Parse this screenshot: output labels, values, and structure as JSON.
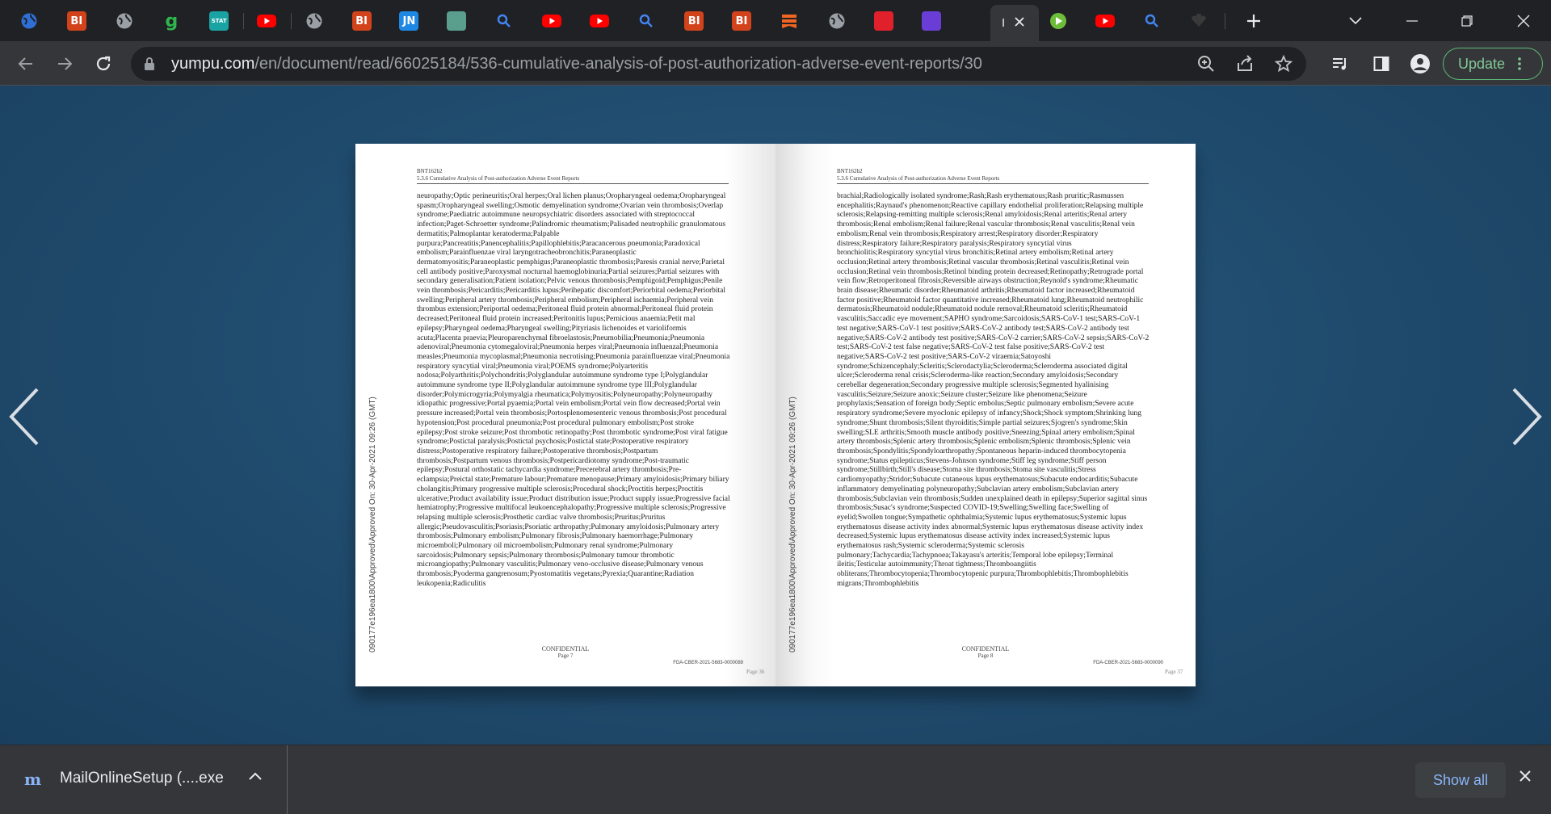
{
  "tabs": [
    {
      "icon": "globe-multicolor-icon",
      "label": "",
      "color": "#2f6fd6"
    },
    {
      "icon": "bi-logo-icon",
      "label": "BI",
      "color": "#d2431c"
    },
    {
      "icon": "globe-icon",
      "label": "",
      "color": "#9aa0a6"
    },
    {
      "icon": "g-logo-icon",
      "label": "g",
      "color": "#2fb64d"
    },
    {
      "icon": "stat-logo-icon",
      "label": "STAT",
      "color": "#1aa3a3"
    },
    {
      "icon": "youtube-icon",
      "label": "",
      "color": "#ff0000"
    },
    {
      "icon": "globe-icon",
      "label": "",
      "color": "#9aa0a6"
    },
    {
      "icon": "bi-logo-icon",
      "label": "BI",
      "color": "#d2431c"
    },
    {
      "icon": "jn-logo-icon",
      "label": "JN",
      "color": "#1e88e5"
    },
    {
      "icon": "medical-logo-icon",
      "label": "",
      "color": "#5a9e8e"
    },
    {
      "icon": "search-icon",
      "label": "",
      "color": "#4285f4"
    },
    {
      "icon": "youtube-icon",
      "label": "",
      "color": "#ff0000"
    },
    {
      "icon": "youtube-icon",
      "label": "",
      "color": "#ff0000"
    },
    {
      "icon": "search-icon",
      "label": "",
      "color": "#4285f4"
    },
    {
      "icon": "bi-logo-icon",
      "label": "BI",
      "color": "#d2431c"
    },
    {
      "icon": "bi-logo-icon",
      "label": "BI",
      "color": "#d2431c"
    },
    {
      "icon": "bookmark-stack-icon",
      "label": "",
      "color": "#f26522"
    },
    {
      "icon": "globe-icon",
      "label": "",
      "color": "#9aa0a6"
    },
    {
      "icon": "red-arrow-icon",
      "label": "",
      "color": "#e0202b"
    },
    {
      "icon": "purple-logo-icon",
      "label": "",
      "color": "#6a3dd6"
    }
  ],
  "tabs_after_active": [
    {
      "icon": "rumble-icon",
      "label": "",
      "color": "#6ebd3a"
    },
    {
      "icon": "youtube-icon",
      "label": "",
      "color": "#ff0000"
    },
    {
      "icon": "search-icon",
      "label": "",
      "color": "#4285f4"
    },
    {
      "icon": "nbc-logo-icon",
      "label": "",
      "color": "#1a1a1a"
    }
  ],
  "active_tab": {
    "label": "I"
  },
  "address_bar": {
    "host": "yumpu.com",
    "path": "/en/document/read/66025184/536-cumulative-analysis-of-post-authorization-adverse-event-reports/30"
  },
  "update_button": {
    "label": "Update"
  },
  "document": {
    "left_page": {
      "header_line1": "BNT162b2",
      "header_line2": "5.3.6 Cumulative Analysis of Post-authorization Adverse Event Reports",
      "body": "neuropathy;Optic perineuritis;Oral herpes;Oral lichen planus;Oropharyngeal oedema;Oropharyngeal spasm;Oropharyngeal swelling;Osmotic demyelination syndrome;Ovarian vein thrombosis;Overlap syndrome;Paediatric autoimmune neuropsychiatric disorders associated with streptococcal infection;Paget-Schroetter syndrome;Palindromic rheumatism;Palisaded neutrophilic granulomatous dermatitis;Palmoplantar keratoderma;Palpable purpura;Pancreatitis;Panencephalitis;Papillophlebitis;Paracancerous pneumonia;Paradoxical embolism;Parainfluenzae viral laryngotracheobronchitis;Paraneoplastic dermatomyositis;Paraneoplastic pemphigus;Paraneoplastic thrombosis;Paresis cranial nerve;Parietal cell antibody positive;Paroxysmal nocturnal haemoglobinuria;Partial seizures;Partial seizures with secondary generalisation;Patient isolation;Pelvic venous thrombosis;Pemphigoid;Pemphigus;Penile vein thrombosis;Pericarditis;Pericarditis lupus;Perihepatic discomfort;Periorbital oedema;Periorbital swelling;Peripheral artery thrombosis;Peripheral embolism;Peripheral ischaemia;Peripheral vein thrombus extension;Periportal oedema;Peritoneal fluid protein abnormal;Peritoneal fluid protein decreased;Peritoneal fluid protein increased;Peritonitis lupus;Pernicious anaemia;Petit mal epilepsy;Pharyngeal oedema;Pharyngeal swelling;Pityriasis lichenoides et varioliformis acuta;Placenta praevia;Pleuroparenchymal fibroelastosis;Pneumobilia;Pneumonia;Pneumonia adenoviral;Pneumonia cytomegaloviral;Pneumonia herpes viral;Pneumonia influenzal;Pneumonia measles;Pneumonia mycoplasmal;Pneumonia necrotising;Pneumonia parainfluenzae viral;Pneumonia respiratory syncytial viral;Pneumonia viral;POEMS syndrome;Polyarteritis nodosa;Polyarthritis;Polychondritis;Polyglandular autoimmune syndrome type I;Polyglandular autoimmune syndrome type II;Polyglandular autoimmune syndrome type III;Polyglandular disorder;Polymicrogyria;Polymyalgia rheumatica;Polymyositis;Polyneuropathy;Polyneuropathy idiopathic progressive;Portal pyaemia;Portal vein embolism;Portal vein flow decreased;Portal vein pressure increased;Portal vein thrombosis;Portosplenomesenteric venous thrombosis;Post procedural hypotension;Post procedural pneumonia;Post procedural pulmonary embolism;Post stroke epilepsy;Post stroke seizure;Post thrombotic retinopathy;Post thrombotic syndrome;Post viral fatigue syndrome;Postictal paralysis;Postictal psychosis;Postictal state;Postoperative respiratory distress;Postoperative respiratory failure;Postoperative thrombosis;Postpartum thrombosis;Postpartum venous thrombosis;Postpericardiotomy syndrome;Post-traumatic epilepsy;Postural orthostatic tachycardia syndrome;Precerebral artery thrombosis;Pre-eclampsia;Preictal state;Premature labour;Premature menopause;Primary amyloidosis;Primary biliary cholangitis;Primary progressive multiple sclerosis;Procedural shock;Proctitis herpes;Proctitis ulcerative;Product availability issue;Product distribution issue;Product supply issue;Progressive facial hemiatrophy;Progressive multifocal leukoencephalopathy;Progressive multiple sclerosis;Progressive relapsing multiple sclerosis;Prosthetic cardiac valve thrombosis;Pruritus;Pruritus allergic;Pseudovasculitis;Psoriasis;Psoriatic arthropathy;Pulmonary amyloidosis;Pulmonary artery thrombosis;Pulmonary embolism;Pulmonary fibrosis;Pulmonary haemorrhage;Pulmonary microemboli;Pulmonary oil microembolism;Pulmonary renal syndrome;Pulmonary sarcoidosis;Pulmonary sepsis;Pulmonary thrombosis;Pulmonary tumour thrombotic microangiopathy;Pulmonary vasculitis;Pulmonary veno-occlusive disease;Pulmonary venous thrombosis;Pyoderma gangrenosum;Pyostomatitis vegetans;Pyrexia;Quarantine;Radiation leukopenia;Radiculitis",
      "side_stamp": "090177e196ea1800\\Approved\\Approved On: 30-Apr-2021 09:26 (GMT)",
      "confidential": "CONFIDENTIAL",
      "page_label": "Page 7",
      "fda_ref": "FDA-CBER-2021-5683-0000089",
      "viewer_page": "Page 36"
    },
    "right_page": {
      "header_line1": "BNT162b2",
      "header_line2": "5.3.6 Cumulative Analysis of Post-authorization Adverse Event Reports",
      "body": "brachial;Radiologically isolated syndrome;Rash;Rash erythematous;Rash pruritic;Rasmussen encephalitis;Raynaud's phenomenon;Reactive capillary endothelial proliferation;Relapsing multiple sclerosis;Relapsing-remitting multiple sclerosis;Renal amyloidosis;Renal arteritis;Renal artery thrombosis;Renal embolism;Renal failure;Renal vascular thrombosis;Renal vasculitis;Renal vein embolism;Renal vein thrombosis;Respiratory arrest;Respiratory disorder;Respiratory distress;Respiratory failure;Respiratory paralysis;Respiratory syncytial virus bronchiolitis;Respiratory syncytial virus bronchitis;Retinal artery embolism;Retinal artery occlusion;Retinal artery thrombosis;Retinal vascular thrombosis;Retinal vasculitis;Retinal vein occlusion;Retinal vein thrombosis;Retinol binding protein decreased;Retinopathy;Retrograde portal vein flow;Retroperitoneal fibrosis;Reversible airways obstruction;Reynold's syndrome;Rheumatic brain disease;Rheumatic disorder;Rheumatoid arthritis;Rheumatoid factor increased;Rheumatoid factor positive;Rheumatoid factor quantitative increased;Rheumatoid lung;Rheumatoid neutrophilic dermatosis;Rheumatoid nodule;Rheumatoid nodule removal;Rheumatoid scleritis;Rheumatoid vasculitis;Saccadic eye movement;SAPHO syndrome;Sarcoidosis;SARS-CoV-1 test;SARS-CoV-1 test negative;SARS-CoV-1 test positive;SARS-CoV-2 antibody test;SARS-CoV-2 antibody test negative;SARS-CoV-2 antibody test positive;SARS-CoV-2 carrier;SARS-CoV-2 sepsis;SARS-CoV-2 test;SARS-CoV-2 test false negative;SARS-CoV-2 test false positive;SARS-CoV-2 test negative;SARS-CoV-2 test positive;SARS-CoV-2 viraemia;Satoyoshi syndrome;Schizencephaly;Scleritis;Sclerodactylia;Scleroderma;Scleroderma associated digital ulcer;Scleroderma renal crisis;Scleroderma-like reaction;Secondary amyloidosis;Secondary cerebellar degeneration;Secondary progressive multiple sclerosis;Segmented hyalinising vasculitis;Seizure;Seizure anoxic;Seizure cluster;Seizure like phenomena;Seizure prophylaxis;Sensation of foreign body;Septic embolus;Septic pulmonary embolism;Severe acute respiratory syndrome;Severe myoclonic epilepsy of infancy;Shock;Shock symptom;Shrinking lung syndrome;Shunt thrombosis;Silent thyroiditis;Simple partial seizures;Sjogren's syndrome;Skin swelling;SLE arthritis;Smooth muscle antibody positive;Sneezing;Spinal artery embolism;Spinal artery thrombosis;Splenic artery thrombosis;Splenic embolism;Splenic thrombosis;Splenic vein thrombosis;Spondylitis;Spondyloarthropathy;Spontaneous heparin-induced thrombocytopenia syndrome;Status epilepticus;Stevens-Johnson syndrome;Stiff leg syndrome;Stiff person syndrome;Stillbirth;Still's disease;Stoma site thrombosis;Stoma site vasculitis;Stress cardiomyopathy;Stridor;Subacute cutaneous lupus erythematosus;Subacute endocarditis;Subacute inflammatory demyelinating polyneuropathy;Subclavian artery embolism;Subclavian artery thrombosis;Subclavian vein thrombosis;Sudden unexplained death in epilepsy;Superior sagittal sinus thrombosis;Susac's syndrome;Suspected COVID-19;Swelling;Swelling face;Swelling of eyelid;Swollen tongue;Sympathetic ophthalmia;Systemic lupus erythematosus;Systemic lupus erythematosus disease activity index abnormal;Systemic lupus erythematosus disease activity index decreased;Systemic lupus erythematosus disease activity index increased;Systemic lupus erythematosus rash;Systemic scleroderma;Systemic sclerosis pulmonary;Tachycardia;Tachypnoea;Takayasu's arteritis;Temporal lobe epilepsy;Terminal ileitis;Testicular autoimmunity;Throat tightness;Thromboangiitis obliterans;Thrombocytopenia;Thrombocytopenic purpura;Thrombophlebitis;Thrombophlebitis migrans;Thrombophlebitis",
      "side_stamp": "090177e196ea1800\\Approved\\Approved On: 30-Apr-2021 09:26 (GMT)",
      "confidential": "CONFIDENTIAL",
      "page_label": "Page 8",
      "fda_ref": "FDA-CBER-2021-5683-0000090",
      "viewer_page": "Page 37"
    }
  },
  "download_bar": {
    "file_name": "MailOnlineSetup (....exe",
    "show_all": "Show all"
  },
  "colors": {
    "viewer_bg": "#1e4a6a",
    "update_green": "#81c995",
    "link_blue": "#8ab4f8"
  }
}
